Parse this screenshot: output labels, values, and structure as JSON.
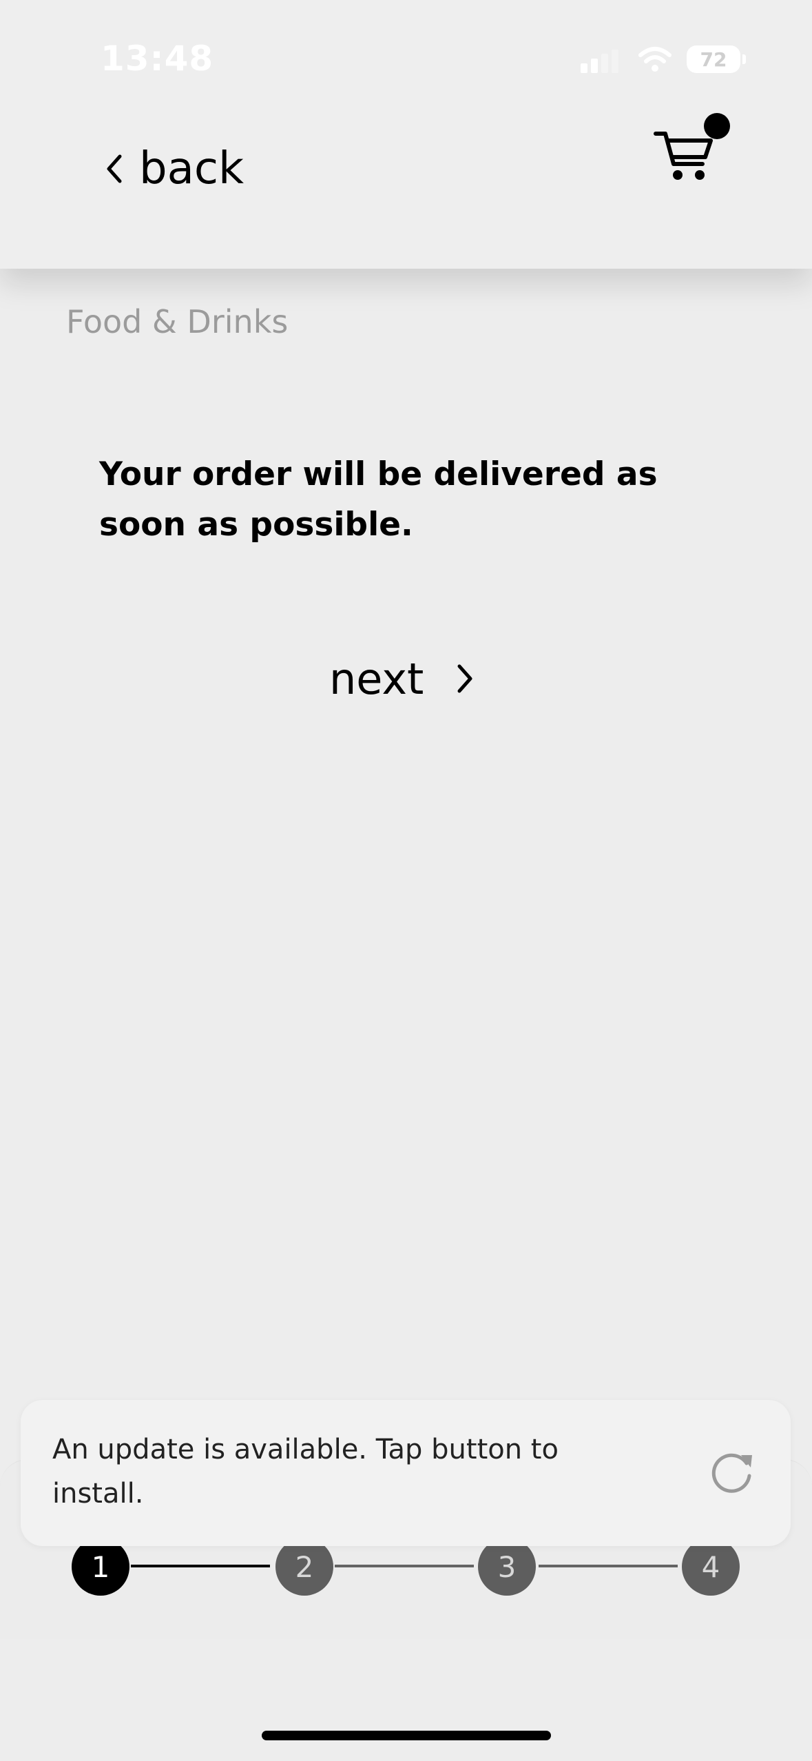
{
  "status_bar": {
    "time": "13:48",
    "battery": "72"
  },
  "header": {
    "back_label": "back",
    "cart_icon": "cart-icon"
  },
  "main": {
    "category": "Food & Drinks",
    "message": "Your order will be delivered as soon as possible.",
    "next_label": "next"
  },
  "stepper": {
    "steps": [
      "1",
      "2",
      "3",
      "4"
    ],
    "current": "1"
  },
  "update_toast": {
    "text": "An update is available. Tap button to install.",
    "icon": "refresh-icon"
  },
  "colors": {
    "background": "#ededed",
    "active_step": "#000000",
    "inactive_step": "#5e5e5e",
    "category_text": "#9b9b9b"
  }
}
